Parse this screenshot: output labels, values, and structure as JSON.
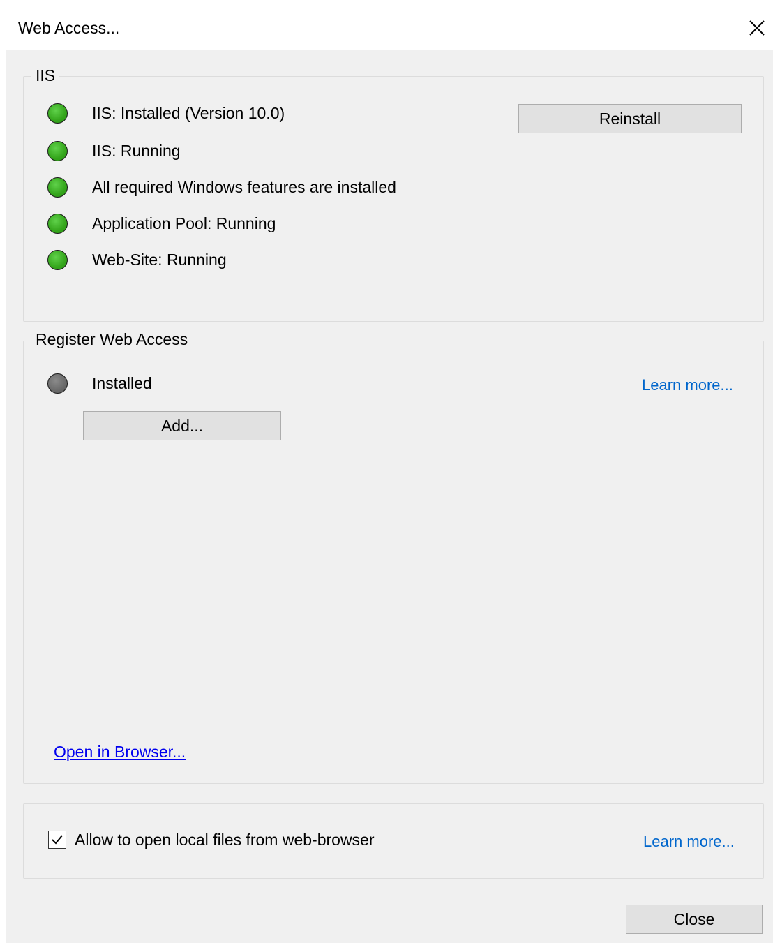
{
  "window": {
    "title": "Web Access..."
  },
  "iis": {
    "legend": "IIS",
    "items": [
      {
        "status": "green",
        "label": "IIS: Installed (Version 10.0)"
      },
      {
        "status": "green",
        "label": "IIS: Running"
      },
      {
        "status": "green",
        "label": "All required Windows features are installed"
      },
      {
        "status": "green",
        "label": "Application Pool: Running"
      },
      {
        "status": "green",
        "label": "Web-Site: Running"
      }
    ],
    "reinstall_label": "Reinstall"
  },
  "register": {
    "legend": "Register Web Access",
    "status": "gray",
    "status_label": "Installed",
    "learn_more": "Learn more...",
    "add_label": "Add...",
    "open_browser": "Open in Browser..."
  },
  "options": {
    "allow_local_files_label": "Allow to open local files from web-browser",
    "allow_local_files_checked": true,
    "learn_more": "Learn more..."
  },
  "footer": {
    "close_label": "Close"
  },
  "colors": {
    "led_green": "#34a51b",
    "led_gray": "#6a6a6a",
    "link": "#0066cc",
    "hyperlink": "#0000ee",
    "window_border": "#3c7fb1"
  }
}
